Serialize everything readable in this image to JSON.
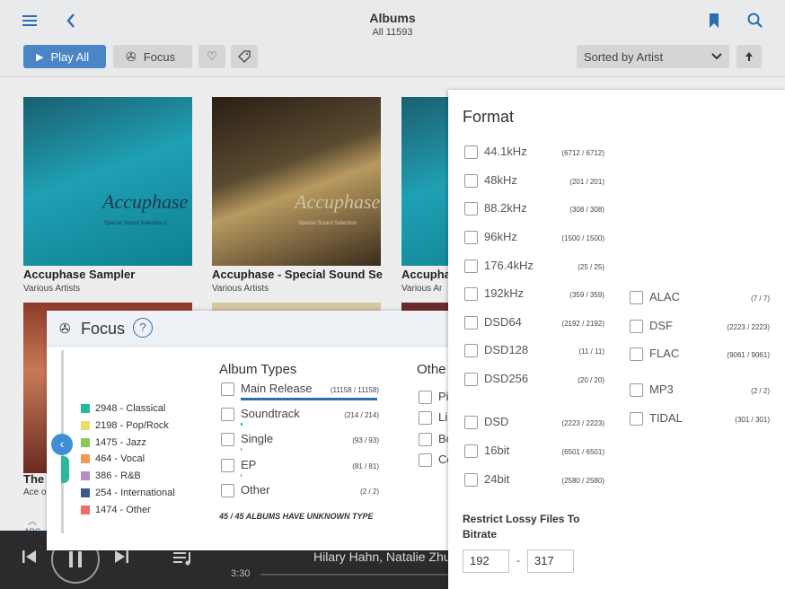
{
  "header": {
    "title": "Albums",
    "subtitle": "All 11593"
  },
  "toolbar": {
    "play_all": "Play All",
    "focus": "Focus",
    "sort": "Sorted by Artist"
  },
  "albums": [
    {
      "title": "Accuphase Sampler",
      "artist": "Various Artists",
      "brand": "Accuphase",
      "cover_sub": "Special Sound Selection 2"
    },
    {
      "title": "Accuphase - Special Sound Sel",
      "artist": "Various Artists",
      "brand": "Accuphase",
      "cover_sub": "Special Sound Selection"
    },
    {
      "title": "Accupha",
      "artist": "Various Ar"
    },
    {
      "title": "The",
      "artist": "Ace o"
    }
  ],
  "nav": {
    "abc": "ABC"
  },
  "player": {
    "track": "Hilary Hahn, Natalie Zhu,",
    "time": "3:30"
  },
  "focus_panel": {
    "title": "Focus",
    "help": "?",
    "genres": [
      {
        "label": "2948 - Classical",
        "color": "#2cb89a"
      },
      {
        "label": "2198 - Pop/Rock",
        "color": "#e9dc72"
      },
      {
        "label": "1475 - Jazz",
        "color": "#8fc85a"
      },
      {
        "label": "464 - Vocal",
        "color": "#f09a5a"
      },
      {
        "label": "386 - R&B",
        "color": "#b88ac9"
      },
      {
        "label": "254 - International",
        "color": "#3f5a8a"
      },
      {
        "label": "1474 - Other",
        "color": "#f06a6a"
      }
    ],
    "album_types_heading": "Album Types",
    "album_types": [
      {
        "label": "Main Release",
        "count": "(11158 / 11158)"
      },
      {
        "label": "Soundtrack",
        "count": "(214 / 214)"
      },
      {
        "label": "Single",
        "count": "(93 / 93)"
      },
      {
        "label": "EP",
        "count": "(81 / 81)"
      },
      {
        "label": "Other",
        "count": "(2 / 2)"
      }
    ],
    "unknown_note": "45 / 45 ALBUMS HAVE UNKNOWN TYPE",
    "other_heading": "Othe",
    "other_items": [
      "Pi",
      "Li",
      "Bo",
      "Co"
    ]
  },
  "format_panel": {
    "title": "Format",
    "left": [
      {
        "label": "44.1kHz",
        "count": "(6712 / 6712)"
      },
      {
        "label": "48kHz",
        "count": "(201 / 201)"
      },
      {
        "label": "88.2kHz",
        "count": "(308 / 308)"
      },
      {
        "label": "96kHz",
        "count": "(1500 / 1500)"
      },
      {
        "label": "176.4kHz",
        "count": "(25 / 25)"
      },
      {
        "label": "192kHz",
        "count": "(359 / 359)"
      },
      {
        "label": "DSD64",
        "count": "(2192 / 2192)"
      },
      {
        "label": "DSD128",
        "count": "(11 / 11)"
      },
      {
        "label": "DSD256",
        "count": "(20 / 20)"
      },
      {
        "label": "DSD",
        "count": "(2223 / 2223)"
      },
      {
        "label": "16bit",
        "count": "(6501 / 6501)"
      },
      {
        "label": "24bit",
        "count": "(2580 / 2580)"
      }
    ],
    "right": [
      {
        "label": "ALAC",
        "count": "(7 / 7)"
      },
      {
        "label": "DSF",
        "count": "(2223 / 2223)"
      },
      {
        "label": "FLAC",
        "count": "(9061 / 9061)"
      },
      {
        "label": "MP3",
        "count": "(2 / 2)"
      },
      {
        "label": "TIDAL",
        "count": "(301 / 301)"
      }
    ],
    "restrict_line1": "Restrict Lossy Files To",
    "restrict_line2": "Bitrate",
    "bitrate_min": "192",
    "bitrate_max": "317",
    "separator": "-"
  }
}
